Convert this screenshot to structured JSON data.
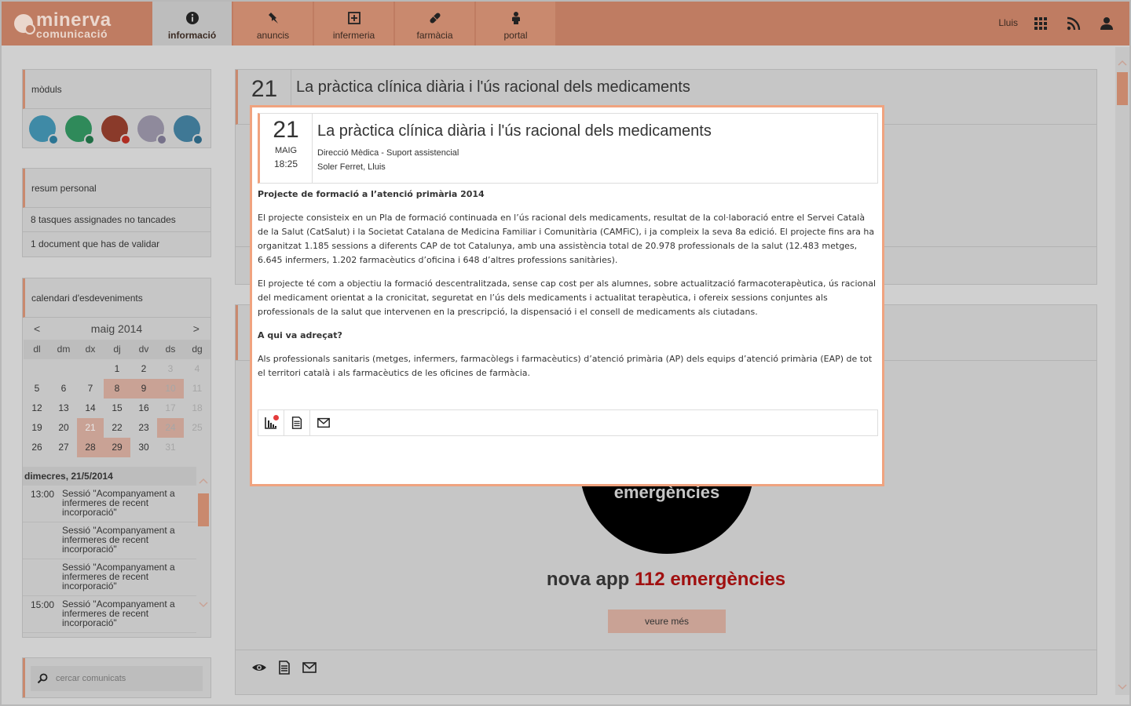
{
  "brand": {
    "name": "minerva",
    "subtitle": "comunicació"
  },
  "nav": {
    "tabs": [
      {
        "label": "informació",
        "icon": "info-icon",
        "active": true
      },
      {
        "label": "anuncis",
        "icon": "pin-icon"
      },
      {
        "label": "infermeria",
        "icon": "plus-box-icon"
      },
      {
        "label": "farmàcia",
        "icon": "pill-icon"
      },
      {
        "label": "portal",
        "icon": "person-icon"
      }
    ],
    "user": "Lluis"
  },
  "colors": {
    "accent": "#bf7c62",
    "modal_border": "#f0a37f",
    "promo_red": "#a01010"
  },
  "sidebar": {
    "modules": {
      "title": "mòduls",
      "circles": [
        {
          "color": "#3f8aa6",
          "dot": "#2c7593"
        },
        {
          "color": "#2f8a5a",
          "dot": "#1f6e45"
        },
        {
          "color": "#8a3a2a",
          "dot": "#b02d22"
        },
        {
          "color": "#8f8a9c",
          "dot": "#76718a"
        },
        {
          "color": "#3f7895",
          "dot": "#2c6582"
        }
      ]
    },
    "summary": {
      "title": "resum personal",
      "items": [
        "8 tasques assignades no tancades",
        "1 document que has de validar"
      ]
    },
    "calendar": {
      "title": "calendari d'esdeveniments",
      "prev": "<",
      "next": ">",
      "month": "maig 2014",
      "weekdays": [
        "dl",
        "dm",
        "dx",
        "dj",
        "dv",
        "ds",
        "dg"
      ],
      "weeks": [
        [
          "",
          "",
          "",
          "1",
          "2",
          "3",
          "4"
        ],
        [
          "5",
          "6",
          "7",
          "8",
          "9",
          "10",
          "11"
        ],
        [
          "12",
          "13",
          "14",
          "15",
          "16",
          "17",
          "18"
        ],
        [
          "19",
          "20",
          "21",
          "22",
          "23",
          "24",
          "25"
        ],
        [
          "26",
          "27",
          "28",
          "29",
          "30",
          "31",
          ""
        ]
      ],
      "event_days": [
        "8",
        "9",
        "10",
        "24",
        "28",
        "29"
      ],
      "today": "21",
      "selected_day_label": "dimecres, 21/5/2014",
      "events": [
        {
          "time": "13:00",
          "text": "Sessió \"Acompanyament a infermeres de recent incorporació\""
        },
        {
          "time": "",
          "text": "Sessió \"Acompanyament a infermeres de recent incorporació\""
        },
        {
          "time": "",
          "text": "Sessió \"Acompanyament a infermeres de recent incorporació\""
        },
        {
          "time": "15:00",
          "text": "Sessió \"Acompanyament a infermeres de recent incorporació\""
        }
      ]
    },
    "search": {
      "placeholder": "cercar comunicats"
    }
  },
  "main": {
    "card1": {
      "day": "21",
      "title": "La pràctica clínica diària i l'ús racional dels medicaments"
    },
    "promo": {
      "circle_text": "emergències",
      "text_prefix": "nova app ",
      "text_highlight": "112 emergències",
      "button": "veure més"
    }
  },
  "modal": {
    "day": "21",
    "month": "MAIG",
    "time": "18:25",
    "title": "La pràctica clínica diària i l'ús racional dels medicaments",
    "department": "Direcció Mèdica - Suport assistencial",
    "author": "Soler Ferret, Lluis",
    "heading1": "Projecte de formació a l’atenció primària 2014",
    "para1": "El projecte consisteix en un Pla de formació continuada en l’ús racional dels medicaments, resultat de la col·laboració entre el Servei Català de la Salut (CatSalut) i la Societat Catalana de Medicina Familiar i Comunitària (CAMFiC), i ja compleix la seva 8a edició. El projecte fins ara ha organitzat 1.185 sessions a diferents CAP de tot Catalunya, amb una assistència total de 20.978 professionals de la salut (12.483 metges, 6.645 infermers, 1.202 farmacèutics d’oficina i 648 d’altres professions sanitàries).",
    "para2": "El projecte té com a objectiu la formació descentralitzada, sense cap cost per als alumnes, sobre actualització farmacoterapèutica, ús racional del medicament orientat a la cronicitat, seguretat en l’ús dels medicaments i actualitat terapèutica, i ofereix sessions conjuntes als professionals de la salut que intervenen en la prescripció, la dispensació i el consell de medicaments als ciutadans.",
    "heading2": "A qui va adreçat?",
    "para3": "Als professionals sanitaris (metges, infermers, farmacòlegs i farmacèutics) d’atenció primària (AP) dels equips d’atenció primària (EAP) de tot el territori català i als farmacèutics de les oficines de farmàcia."
  }
}
